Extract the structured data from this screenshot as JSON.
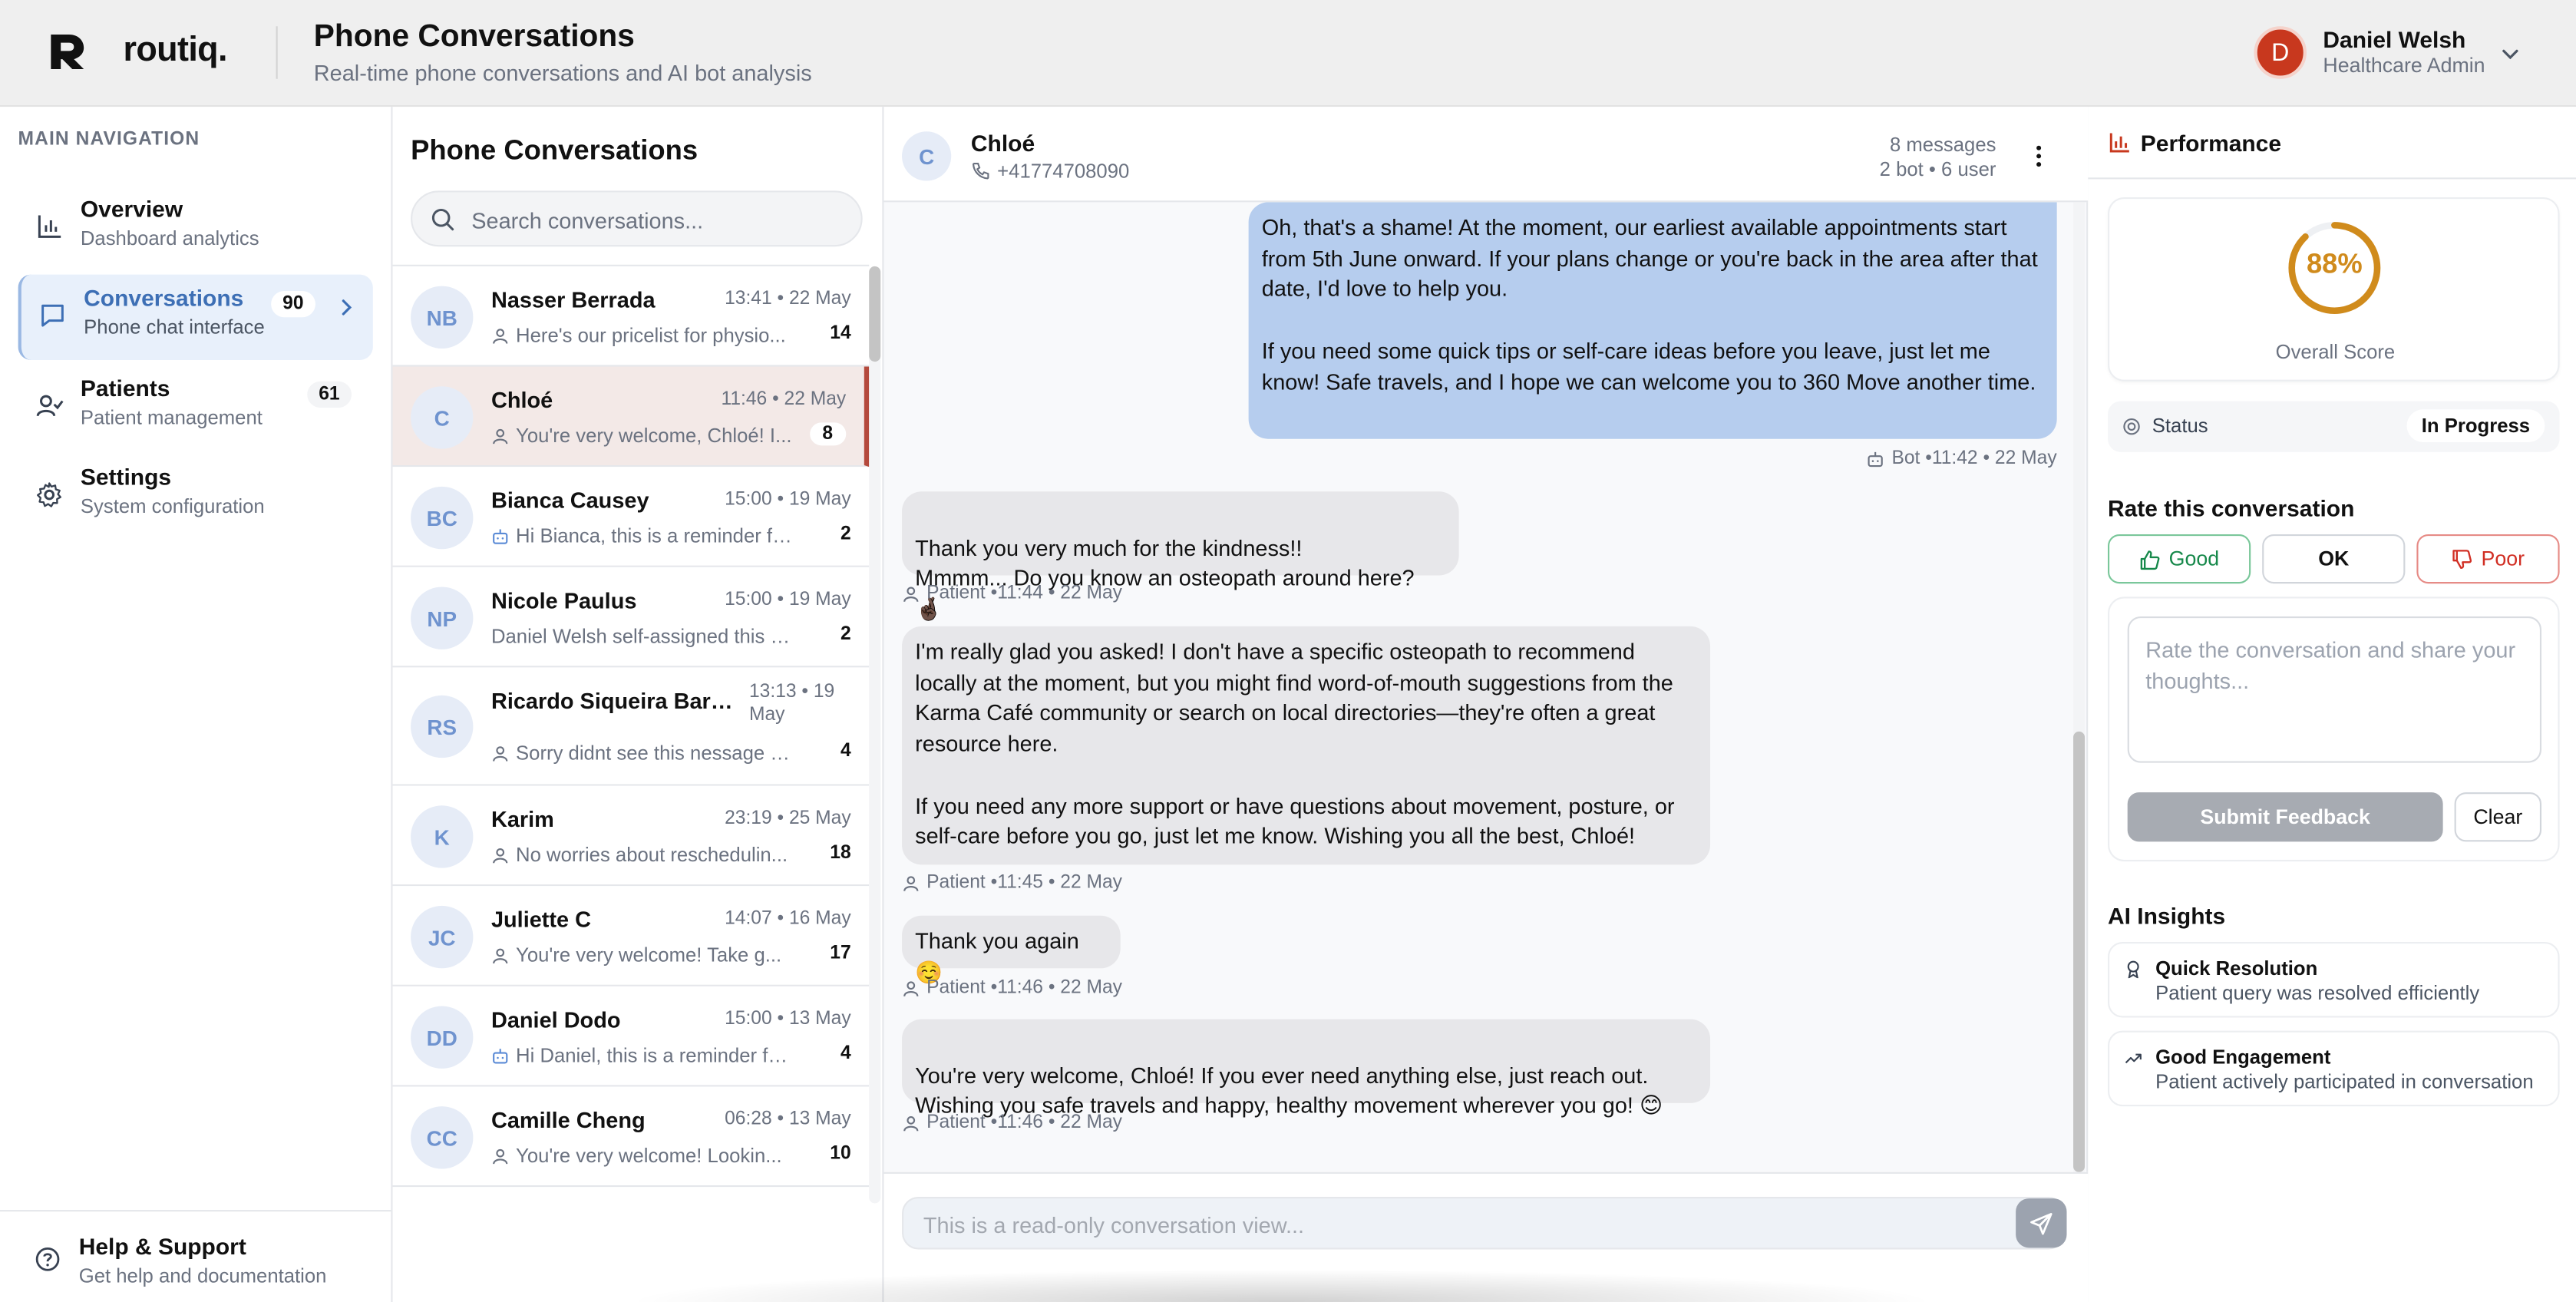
{
  "app": {
    "logo_text": "routiq.",
    "page_title": "Phone Conversations",
    "page_subtitle": "Real-time phone conversations and AI bot analysis"
  },
  "user": {
    "initial": "D",
    "name": "Daniel Welsh",
    "role": "Healthcare Admin"
  },
  "sidebar": {
    "heading": "MAIN NAVIGATION",
    "items": [
      {
        "label": "Overview",
        "sub": "Dashboard analytics",
        "icon": "bar-chart-icon"
      },
      {
        "label": "Conversations",
        "sub": "Phone chat interface",
        "badge": "90",
        "icon": "message-square-icon",
        "active": true
      },
      {
        "label": "Patients",
        "sub": "Patient management",
        "badge": "61",
        "icon": "user-check-icon"
      },
      {
        "label": "Settings",
        "sub": "System configuration",
        "icon": "gear-icon"
      }
    ],
    "help": {
      "label": "Help & Support",
      "sub": "Get help and documentation",
      "icon": "help-circle-icon"
    }
  },
  "conversation_list": {
    "title": "Phone Conversations",
    "search_placeholder": "Search conversations...",
    "rows": [
      {
        "initials": "NB",
        "name": "Nasser Berrada",
        "time": "13:41 • 22 May",
        "preview": "Here's our pricelist for physio...",
        "preview_icon": "user-icon",
        "count": "14"
      },
      {
        "initials": "C",
        "name": "Chloé",
        "time": "11:46 • 22 May",
        "preview": "You're very welcome, Chloé! I...",
        "preview_icon": "user-icon",
        "count": "8",
        "selected": true
      },
      {
        "initials": "BC",
        "name": "Bianca Causey",
        "time": "15:00 • 19 May",
        "preview": "Hi Bianca, this is a reminder fo...",
        "preview_icon": "bot-icon",
        "count": "2"
      },
      {
        "initials": "NP",
        "name": "Nicole Paulus",
        "time": "15:00 • 19 May",
        "preview": "Daniel Welsh self-assigned this c...",
        "preview_icon": "",
        "count": "2"
      },
      {
        "initials": "RS",
        "name": "Ricardo Siqueira Barros...",
        "time": "13:13 • 19 May",
        "preview": "Sorry didnt see this nessage b...",
        "preview_icon": "user-icon",
        "count": "4"
      },
      {
        "initials": "K",
        "name": "Karim",
        "time": "23:19 • 25 May",
        "preview": "No worries about reschedulin...",
        "preview_icon": "user-icon",
        "count": "18"
      },
      {
        "initials": "JC",
        "name": "Juliette C",
        "time": "14:07 • 16 May",
        "preview": "You're very welcome! Take g...",
        "preview_icon": "user-icon",
        "count": "17"
      },
      {
        "initials": "DD",
        "name": "Daniel Dodo",
        "time": "15:00 • 13 May",
        "preview": "Hi Daniel, this is a reminder for...",
        "preview_icon": "bot-icon",
        "count": "4"
      },
      {
        "initials": "CC",
        "name": "Camille Cheng",
        "time": "06:28 • 13 May",
        "preview": "You're very welcome! Lookin...",
        "preview_icon": "user-icon",
        "count": "10"
      }
    ]
  },
  "chat": {
    "initial": "C",
    "name": "Chloé",
    "phone": "+41774708090",
    "message_count": "8 messages",
    "breakdown": "2 bot • 6 user",
    "messages": [
      {
        "role": "bot",
        "paragraphs": [
          "Oh, that's a shame! At the moment, our earliest available appointments start from 5th June onward. If your plans change or you're back in the area after that date, I'd love to help you.",
          "If you need some quick tips or self-care ideas before you leave, just let me know! Safe travels, and I hope we can welcome you to 360 Move another time."
        ],
        "meta": "Bot •11:42 • 22 May"
      },
      {
        "role": "user",
        "paragraphs": [
          "Thank you very much for the kindness!!\nMmmm... Do you know an osteopath around here? 🤞🏿"
        ],
        "meta": "Patient •11:44 • 22 May"
      },
      {
        "role": "user",
        "paragraphs": [
          "I'm really glad you asked! I don't have a specific osteopath to recommend locally at the moment, but you might find word-of-mouth suggestions from the Karma Café community or search on local directories—they're often a great resource here.",
          "If you need any more support or have questions about movement, posture, or self-care before you go, just let me know. Wishing you all the best, Chloé!"
        ],
        "meta": "Patient •11:45 • 22 May"
      },
      {
        "role": "user",
        "paragraphs": [
          "Thank you again ☺️"
        ],
        "meta": "Patient •11:46 • 22 May"
      },
      {
        "role": "user",
        "paragraphs": [
          "You're very welcome, Chloé! If you ever need anything else, just reach out.\nWishing you safe travels and happy, healthy movement wherever you go! 😊"
        ],
        "meta": "Patient •11:46 • 22 May"
      }
    ],
    "input_placeholder": "This is a read-only conversation view..."
  },
  "performance": {
    "title": "Performance",
    "score": "88%",
    "score_fraction": 0.88,
    "score_label": "Overall Score",
    "status_label": "Status",
    "status_value": "In Progress",
    "rate_title": "Rate this conversation",
    "rate_good": "Good",
    "rate_ok": "OK",
    "rate_poor": "Poor",
    "feedback_placeholder": "Rate the conversation and share your thoughts...",
    "submit_label": "Submit Feedback",
    "clear_label": "Clear",
    "insights_title": "AI Insights",
    "insights": [
      {
        "title": "Quick Resolution",
        "desc": "Patient query was resolved efficiently",
        "icon": "award-icon"
      },
      {
        "title": "Good Engagement",
        "desc": "Patient actively participated in conversation",
        "icon": "trending-up-icon"
      }
    ]
  },
  "colors": {
    "accent": "#3d6fb5",
    "bot_bubble": "#b6cdee",
    "user_bubble": "#e7e7ea",
    "score": "#d08b1c",
    "good": "#16884a",
    "poor": "#d12e23",
    "avatar_user": "#c8381e"
  }
}
